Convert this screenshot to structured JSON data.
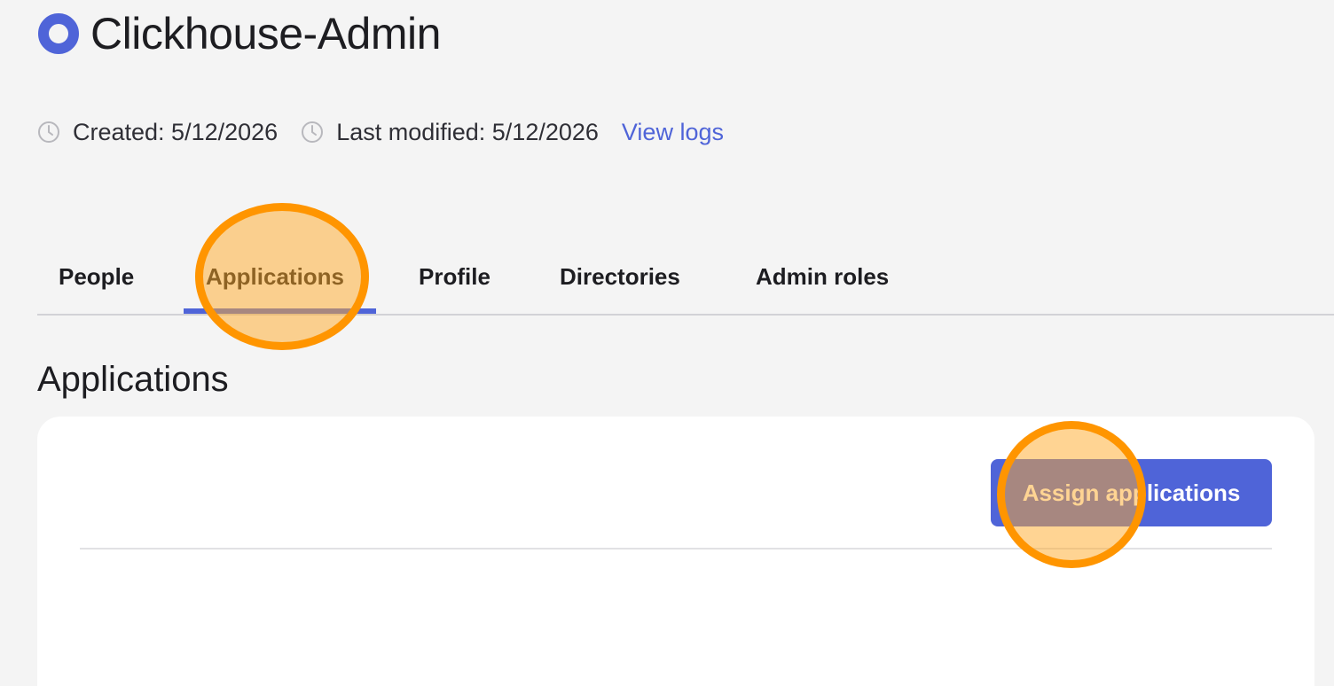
{
  "group": {
    "title": "Clickhouse-Admin",
    "icon": "group-ring-icon",
    "accent_color": "#4f64d8"
  },
  "meta": {
    "created_label": "Created: 5/12/2026",
    "modified_label": "Last modified: 5/12/2026",
    "view_logs_label": "View logs",
    "icon": "clock-icon"
  },
  "tabs": [
    {
      "label": "People",
      "active": false
    },
    {
      "label": "Applications",
      "active": true
    },
    {
      "label": "Profile",
      "active": false
    },
    {
      "label": "Directories",
      "active": false
    },
    {
      "label": "Admin roles",
      "active": false
    }
  ],
  "section": {
    "title": "Applications"
  },
  "actions": {
    "assign_label": "Assign applications"
  },
  "highlights": {
    "color": "#ff9500"
  }
}
